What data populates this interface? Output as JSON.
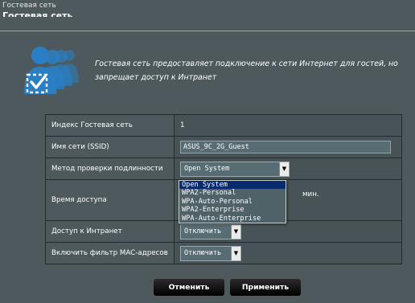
{
  "breadcrumb": "Гостевая сеть",
  "page_title": "Гостевая сеть",
  "description": "Гостевая сеть предоставляет подключение к сети Интернет для гостей, но запрещает доступ к Интранет",
  "rows": {
    "index": {
      "label": "Индекс Гостевая сеть",
      "value": "1"
    },
    "ssid": {
      "label": "Имя сети (SSID)",
      "value": "ASUS_9C_2G_Guest"
    },
    "auth": {
      "label": "Метод проверки подлинности",
      "value": "Open System",
      "options": [
        "Open System",
        "WPA2-Personal",
        "WPA-Auto-Personal",
        "WPA2-Enterprise",
        "WPA-Auto-Enterprise"
      ]
    },
    "access_time": {
      "label": "Время доступа",
      "unit": "мин."
    },
    "intranet": {
      "label": "Доступ к Интранет",
      "value": "Отключить"
    },
    "mac_filter": {
      "label": "Включить фильтр MAC-адресов",
      "value": "Отключить"
    }
  },
  "buttons": {
    "cancel": "Отменить",
    "apply": "Применить"
  },
  "icons": {
    "users": "guest-users-icon",
    "arrow": "chevron-down-icon"
  }
}
